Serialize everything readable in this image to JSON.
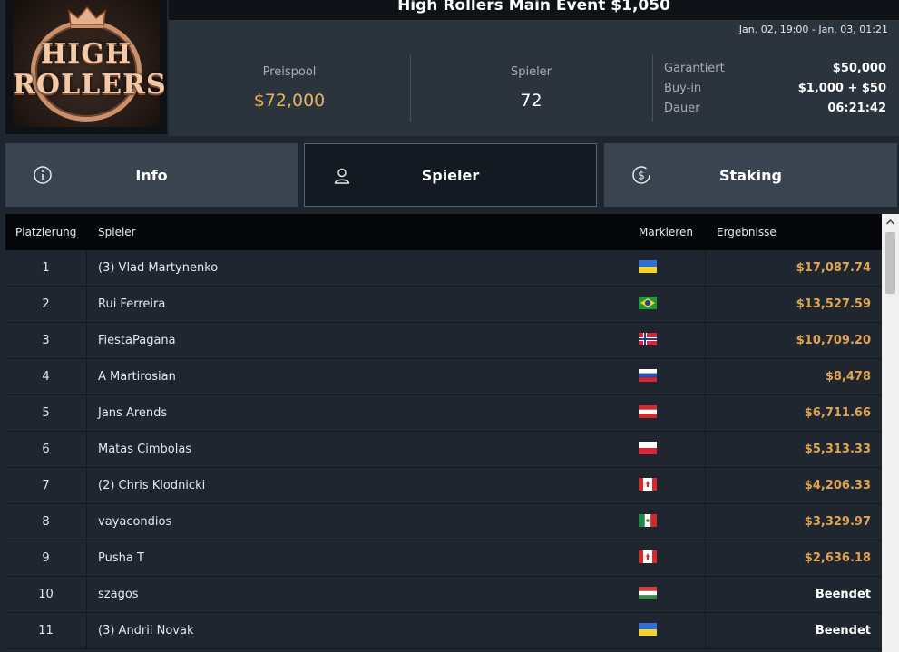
{
  "logo": {
    "line1": "HIGH",
    "line2": "ROLLERS"
  },
  "header": {
    "title": "High Rollers Main Event $1,050",
    "date_range": "Jan. 02, 19:00 - Jan. 03, 01:21"
  },
  "stats": {
    "prizepool_label": "Preispool",
    "prizepool_value": "$72,000",
    "players_label": "Spieler",
    "players_value": "72",
    "details": [
      {
        "label": "Garantiert",
        "value": "$50,000"
      },
      {
        "label": "Buy-in",
        "value": "$1,000 + $50"
      },
      {
        "label": "Dauer",
        "value": "06:21:42"
      }
    ]
  },
  "tabs": [
    {
      "label": "Info",
      "icon": "info-icon",
      "active": false
    },
    {
      "label": "Spieler",
      "icon": "user-icon",
      "active": true
    },
    {
      "label": "Staking",
      "icon": "dollar-coin-icon",
      "active": false
    }
  ],
  "table": {
    "headers": [
      "Platzierung",
      "Spieler",
      "Markieren",
      "Ergebnisse"
    ],
    "rows": [
      {
        "rank": "1",
        "name": "(3) Vlad Martynenko",
        "flag": "ukraine",
        "result": "$17,087.74"
      },
      {
        "rank": "2",
        "name": "Rui Ferreira",
        "flag": "brazil",
        "result": "$13,527.59"
      },
      {
        "rank": "3",
        "name": "FiestaPagana",
        "flag": "norway",
        "result": "$10,709.20"
      },
      {
        "rank": "4",
        "name": "A Martirosian",
        "flag": "russia",
        "result": "$8,478"
      },
      {
        "rank": "5",
        "name": "Jans Arends",
        "flag": "austria",
        "result": "$6,711.66"
      },
      {
        "rank": "6",
        "name": "Matas Cimbolas",
        "flag": "poland",
        "result": "$5,313.33"
      },
      {
        "rank": "7",
        "name": "(2) Chris Klodnicki",
        "flag": "canada",
        "result": "$4,206.33"
      },
      {
        "rank": "8",
        "name": "vayacondios",
        "flag": "mexico",
        "result": "$3,329.97"
      },
      {
        "rank": "9",
        "name": "Pusha T",
        "flag": "canada",
        "result": "$2,636.18"
      },
      {
        "rank": "10",
        "name": "szagos",
        "flag": "hungary",
        "result": "Beendet"
      },
      {
        "rank": "11",
        "name": "(3) Andrii Novak",
        "flag": "ukraine",
        "result": "Beendet"
      }
    ]
  },
  "colors": {
    "accent_gold": "#e0a451",
    "prizepool_gold": "#e6b45f",
    "panel": "#2b333d",
    "tab_inactive": "#3a4450",
    "tab_active": "#141a21"
  }
}
